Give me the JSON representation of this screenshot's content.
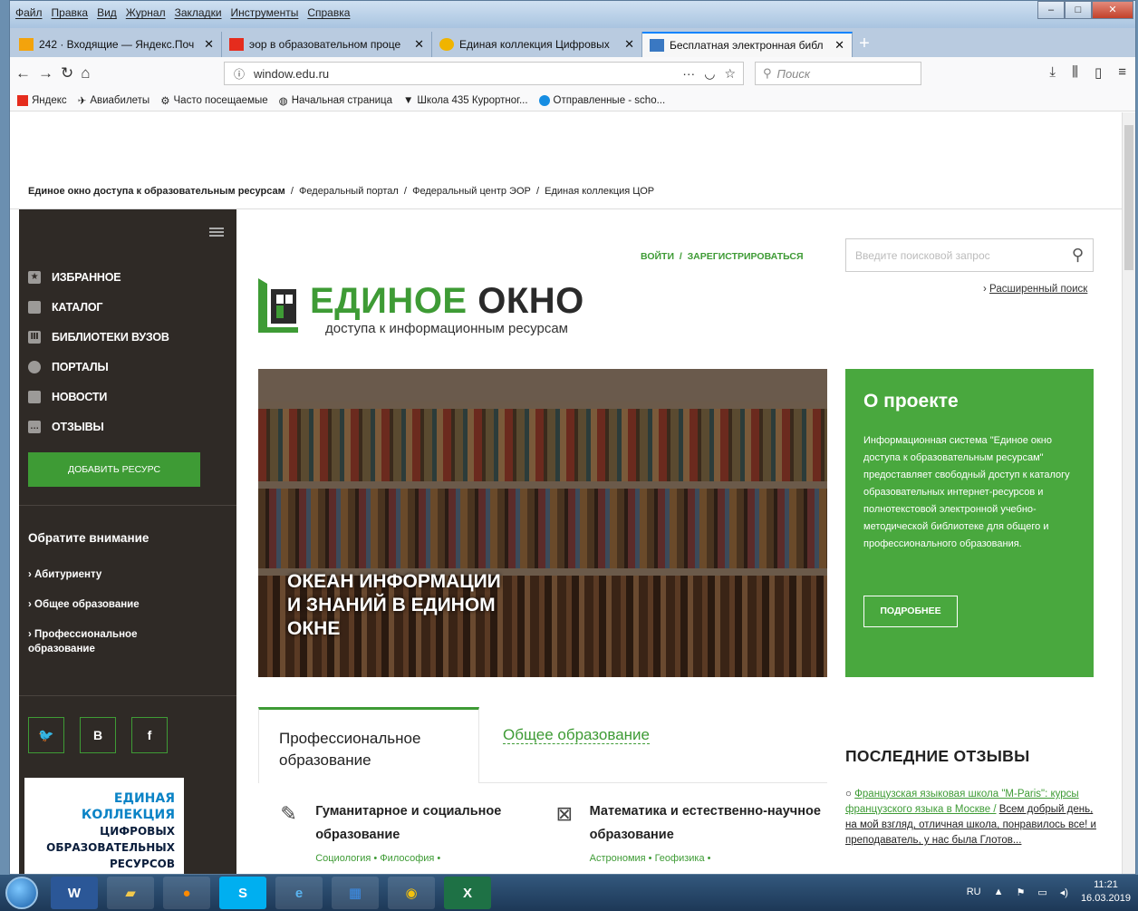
{
  "browser": {
    "menu": [
      "Файл",
      "Правка",
      "Вид",
      "Журнал",
      "Закладки",
      "Инструменты",
      "Справка"
    ],
    "tabs": [
      {
        "title": "242 · Входящие — Яндекс.Поч",
        "color": "#f3a30c"
      },
      {
        "title": "эор в образовательном проце",
        "color": "#e52c1d"
      },
      {
        "title": "Единая коллекция Цифровых",
        "color": "#f0b400"
      },
      {
        "title": "Бесплатная электронная библ",
        "color": "#3a78c2"
      }
    ],
    "tab_close": "✕",
    "new_tab": "+",
    "url": "window.edu.ru",
    "search_placeholder": "Поиск",
    "bookmarks": [
      "Яндекс",
      "Авиабилеты",
      "Часто посещаемые",
      "Начальная страница",
      "Школа 435 Курортног...",
      "Отправленные - scho..."
    ]
  },
  "site": {
    "breadcrumbs": {
      "home": "Единое окно доступа к образовательным ресурсам",
      "items": [
        "Федеральный портал",
        "Федеральный центр ЭОР",
        "Единая коллекция ЦОР"
      ],
      "sep": "/"
    },
    "sidebar": {
      "nav": [
        {
          "label": "ИЗБРАННОЕ",
          "icon": "star-icon"
        },
        {
          "label": "КАТАЛОГ",
          "icon": "catalog-icon"
        },
        {
          "label": "БИБЛИОТЕКИ ВУЗОВ",
          "icon": "library-icon"
        },
        {
          "label": "ПОРТАЛЫ",
          "icon": "portal-icon"
        },
        {
          "label": "НОВОСТИ",
          "icon": "news-icon"
        },
        {
          "label": "ОТЗЫВЫ",
          "icon": "reviews-icon"
        }
      ],
      "add_resource": "ДОБАВИТЬ РЕСУРС",
      "attention_title": "Обратите внимание",
      "attention_items": [
        "› Абитуриенту",
        "› Общее образование",
        "› Профессиональное образование"
      ],
      "social": [
        "🐦",
        "В",
        "f"
      ],
      "promo": [
        "ЕДИНАЯ КОЛЛЕКЦИЯ",
        "ЦИФРОВЫХ",
        "ОБРАЗОВАТЕЛЬНЫХ",
        "РЕСУРСОВ"
      ]
    },
    "header": {
      "login": "ВОЙТИ",
      "login_sep": "/",
      "register": "ЗАРЕГИСТРИРОВАТЬСЯ",
      "search_placeholder": "Введите поисковой запрос",
      "advanced_search": "Расширенный поиск",
      "logo_title_a": "ЕДИНОЕ",
      "logo_title_b": "ОКНО",
      "logo_subtitle": "доступа к информационным ресурсам"
    },
    "hero": {
      "line1": "ОКЕАН ИНФОРМАЦИИ",
      "line2": "И ЗНАНИЙ В ЕДИНОМ",
      "line3": "ОКНЕ"
    },
    "about": {
      "title": "О проекте",
      "text": "Информационная система \"Единое окно доступа к образовательным ресурсам\" предоставляет свободный доступ к каталогу образовательных интернет-ресурсов и полнотекстовой электронной учебно-методической библиотеке для общего и профессионального образования.",
      "more": "ПОДРОБНЕЕ"
    },
    "edu_tabs": {
      "professional": "Профессиональное образование",
      "general": "Общее образование"
    },
    "categories": [
      {
        "title": "Гуманитарное и социальное образование",
        "sub": "Социология • Философия •",
        "icon": "quill-icon"
      },
      {
        "title": "Математика и естественно-научное образование",
        "sub": "Астрономия • Геофизика •",
        "icon": "math-icon"
      }
    ],
    "reviews": {
      "title": "ПОСЛЕДНИЕ ОТЗЫВЫ",
      "link": "Французская языковая школа \"M-Paris\": курсы французского языка в Москве /",
      "text": "Всем добрый день, на мой взгляд, отличная школа, понравилось все! и преподаватель, у нас была Глотов..."
    }
  },
  "taskbar": {
    "lang": "RU",
    "time": "11:21",
    "date": "16.03.2019"
  }
}
